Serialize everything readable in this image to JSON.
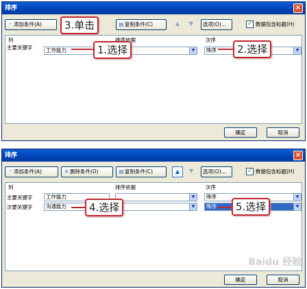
{
  "dialog1": {
    "title": "排序",
    "close": "×",
    "toolbar": {
      "add_label": "添加条件(A)",
      "copy_label": "复制条件(C)",
      "up": "▲",
      "down": "▼",
      "options_label": "选项(O)...",
      "header_check": "✓",
      "header_label": "数据包含标题(H)"
    },
    "headers": {
      "column": "列",
      "sort_on": "排序依据",
      "order": "次序"
    },
    "row1": {
      "label": "主要关键字",
      "column": "工作能力",
      "order": "降序"
    },
    "ok": "确定",
    "cancel": "取消",
    "callouts": {
      "c1": "1.选择",
      "c2": "2.选择",
      "c3": "3.单击"
    }
  },
  "dialog2": {
    "title": "排序",
    "close": "×",
    "toolbar": {
      "add_label": "添加条件(A)",
      "delete_label": "删除条件(D)",
      "copy_label": "复制条件(C)",
      "up": "▲",
      "down": "▼",
      "options_label": "选项(O)...",
      "header_check": "✓",
      "header_label": "数据包含标题(H)"
    },
    "headers": {
      "column": "列",
      "sort_on": "排序依据",
      "order": "次序"
    },
    "row1": {
      "label": "主要关键字",
      "column": "工作能力",
      "order": "降序"
    },
    "row2": {
      "label": "次要关键字",
      "column": "沟通能力",
      "order": "降序"
    },
    "ok": "确定",
    "cancel": "取消",
    "callouts": {
      "c4": "4.选择",
      "c5": "5.选择"
    }
  },
  "watermark": "Baidu 经验",
  "colors": {
    "callout_border": "#c0252e",
    "title_bar": "#0a5fd8"
  }
}
